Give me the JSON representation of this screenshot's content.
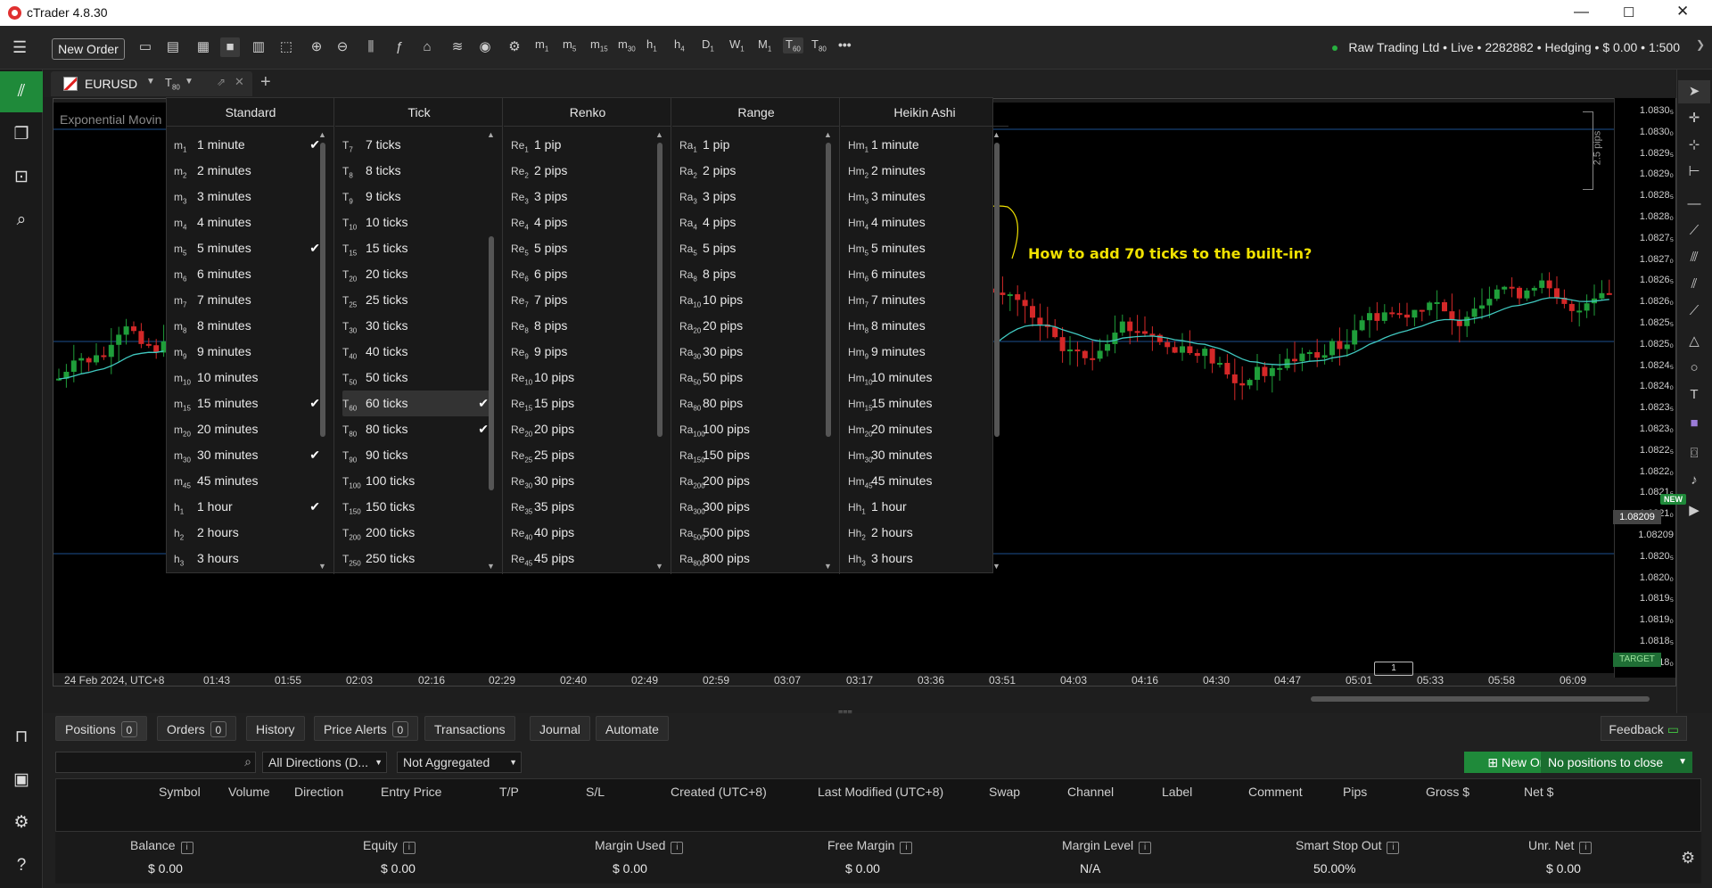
{
  "app": {
    "title": "cTrader 4.8.30"
  },
  "window_buttons": [
    "—",
    "☐",
    "✕"
  ],
  "toolbar": {
    "new_order_label": "New Order",
    "timeframes": [
      {
        "code": "m",
        "sub": "1"
      },
      {
        "code": "m",
        "sub": "5"
      },
      {
        "code": "m",
        "sub": "15"
      },
      {
        "code": "m",
        "sub": "30"
      },
      {
        "code": "h",
        "sub": "1"
      },
      {
        "code": "h",
        "sub": "4"
      },
      {
        "code": "D",
        "sub": "1"
      },
      {
        "code": "W",
        "sub": "1"
      },
      {
        "code": "M",
        "sub": "1"
      },
      {
        "code": "T",
        "sub": "60"
      },
      {
        "code": "T",
        "sub": "80"
      }
    ],
    "more": "•••",
    "account": "Raw Trading Ltd • Live • 2282882 • Hedging • $ 0.00 • 1:500"
  },
  "chart_tab": {
    "symbol": "EURUSD",
    "timeframe": "T",
    "timeframe_sub": "80",
    "add": "+"
  },
  "chart": {
    "indicator": "Exponential Movin",
    "annotation": "How to add 70 ticks to the built-in?",
    "price_labels": [
      "1.0830₅",
      "1.0830₀",
      "1.0829₅",
      "1.0829₀",
      "1.0828₅",
      "1.0828₀",
      "1.0827₅",
      "1.0827₀",
      "1.0826₅",
      "1.0826₀",
      "1.0825₅",
      "1.0825₀",
      "1.0824₅",
      "1.0824₀",
      "1.0823₅",
      "1.0823₀",
      "1.0822₅",
      "1.0822₀",
      "1.0821₅",
      "1.0821₀",
      "1.08209",
      "1.0820₅",
      "1.0820₀",
      "1.0819₅",
      "1.0819₀",
      "1.0818₅",
      "1.0818₀"
    ],
    "current_price": "1.08209",
    "pip_scale": "2.5 pips",
    "target_label": "TARGET",
    "time_labels": [
      "24 Feb 2024, UTC+8",
      "01:43",
      "01:55",
      "02:03",
      "02:16",
      "02:29",
      "02:40",
      "02:49",
      "02:59",
      "03:07",
      "03:17",
      "03:36",
      "03:51",
      "04:03",
      "04:16",
      "04:30",
      "04:47",
      "05:01",
      "05:33",
      "05:58",
      "06:09"
    ],
    "scroll_marker": "1"
  },
  "dropdown": {
    "columns": [
      {
        "title": "Standard",
        "items": [
          {
            "code": "m",
            "sub": "1",
            "label": "1 minute",
            "checked": true
          },
          {
            "code": "m",
            "sub": "2",
            "label": "2 minutes",
            "checked": false
          },
          {
            "code": "m",
            "sub": "3",
            "label": "3 minutes",
            "checked": false
          },
          {
            "code": "m",
            "sub": "4",
            "label": "4 minutes",
            "checked": false
          },
          {
            "code": "m",
            "sub": "5",
            "label": "5 minutes",
            "checked": true
          },
          {
            "code": "m",
            "sub": "6",
            "label": "6 minutes",
            "checked": false
          },
          {
            "code": "m",
            "sub": "7",
            "label": "7 minutes",
            "checked": false
          },
          {
            "code": "m",
            "sub": "8",
            "label": "8 minutes",
            "checked": false
          },
          {
            "code": "m",
            "sub": "9",
            "label": "9 minutes",
            "checked": false
          },
          {
            "code": "m",
            "sub": "10",
            "label": "10 minutes",
            "checked": false
          },
          {
            "code": "m",
            "sub": "15",
            "label": "15 minutes",
            "checked": true
          },
          {
            "code": "m",
            "sub": "20",
            "label": "20 minutes",
            "checked": false
          },
          {
            "code": "m",
            "sub": "30",
            "label": "30 minutes",
            "checked": true
          },
          {
            "code": "m",
            "sub": "45",
            "label": "45 minutes",
            "checked": false
          },
          {
            "code": "h",
            "sub": "1",
            "label": "1 hour",
            "checked": true
          },
          {
            "code": "h",
            "sub": "2",
            "label": "2 hours",
            "checked": false
          },
          {
            "code": "h",
            "sub": "3",
            "label": "3 hours",
            "checked": false
          }
        ]
      },
      {
        "title": "Tick",
        "items": [
          {
            "code": "T",
            "sub": "7",
            "label": "7 ticks",
            "checked": false
          },
          {
            "code": "T",
            "sub": "8",
            "label": "8 ticks",
            "checked": false
          },
          {
            "code": "T",
            "sub": "9",
            "label": "9 ticks",
            "checked": false
          },
          {
            "code": "T",
            "sub": "10",
            "label": "10 ticks",
            "checked": false
          },
          {
            "code": "T",
            "sub": "15",
            "label": "15 ticks",
            "checked": false
          },
          {
            "code": "T",
            "sub": "20",
            "label": "20 ticks",
            "checked": false
          },
          {
            "code": "T",
            "sub": "25",
            "label": "25 ticks",
            "checked": false
          },
          {
            "code": "T",
            "sub": "30",
            "label": "30 ticks",
            "checked": false
          },
          {
            "code": "T",
            "sub": "40",
            "label": "40 ticks",
            "checked": false
          },
          {
            "code": "T",
            "sub": "50",
            "label": "50 ticks",
            "checked": false
          },
          {
            "code": "T",
            "sub": "60",
            "label": "60 ticks",
            "checked": true
          },
          {
            "code": "T",
            "sub": "80",
            "label": "80 ticks",
            "checked": true
          },
          {
            "code": "T",
            "sub": "90",
            "label": "90 ticks",
            "checked": false
          },
          {
            "code": "T",
            "sub": "100",
            "label": "100 ticks",
            "checked": false
          },
          {
            "code": "T",
            "sub": "150",
            "label": "150 ticks",
            "checked": false
          },
          {
            "code": "T",
            "sub": "200",
            "label": "200 ticks",
            "checked": false
          },
          {
            "code": "T",
            "sub": "250",
            "label": "250 ticks",
            "checked": false
          }
        ]
      },
      {
        "title": "Renko",
        "items": [
          {
            "code": "Re",
            "sub": "1",
            "label": "1 pip",
            "checked": false
          },
          {
            "code": "Re",
            "sub": "2",
            "label": "2 pips",
            "checked": false
          },
          {
            "code": "Re",
            "sub": "3",
            "label": "3 pips",
            "checked": false
          },
          {
            "code": "Re",
            "sub": "4",
            "label": "4 pips",
            "checked": false
          },
          {
            "code": "Re",
            "sub": "5",
            "label": "5 pips",
            "checked": false
          },
          {
            "code": "Re",
            "sub": "6",
            "label": "6 pips",
            "checked": false
          },
          {
            "code": "Re",
            "sub": "7",
            "label": "7 pips",
            "checked": false
          },
          {
            "code": "Re",
            "sub": "8",
            "label": "8 pips",
            "checked": false
          },
          {
            "code": "Re",
            "sub": "9",
            "label": "9 pips",
            "checked": false
          },
          {
            "code": "Re",
            "sub": "10",
            "label": "10 pips",
            "checked": false
          },
          {
            "code": "Re",
            "sub": "15",
            "label": "15 pips",
            "checked": false
          },
          {
            "code": "Re",
            "sub": "20",
            "label": "20 pips",
            "checked": false
          },
          {
            "code": "Re",
            "sub": "25",
            "label": "25 pips",
            "checked": false
          },
          {
            "code": "Re",
            "sub": "30",
            "label": "30 pips",
            "checked": false
          },
          {
            "code": "Re",
            "sub": "35",
            "label": "35 pips",
            "checked": false
          },
          {
            "code": "Re",
            "sub": "40",
            "label": "40 pips",
            "checked": false
          },
          {
            "code": "Re",
            "sub": "45",
            "label": "45 pips",
            "checked": false
          }
        ]
      },
      {
        "title": "Range",
        "items": [
          {
            "code": "Ra",
            "sub": "1",
            "label": "1 pip",
            "checked": false
          },
          {
            "code": "Ra",
            "sub": "2",
            "label": "2 pips",
            "checked": false
          },
          {
            "code": "Ra",
            "sub": "3",
            "label": "3 pips",
            "checked": false
          },
          {
            "code": "Ra",
            "sub": "4",
            "label": "4 pips",
            "checked": false
          },
          {
            "code": "Ra",
            "sub": "5",
            "label": "5 pips",
            "checked": false
          },
          {
            "code": "Ra",
            "sub": "8",
            "label": "8 pips",
            "checked": false
          },
          {
            "code": "Ra",
            "sub": "10",
            "label": "10 pips",
            "checked": false
          },
          {
            "code": "Ra",
            "sub": "20",
            "label": "20 pips",
            "checked": false
          },
          {
            "code": "Ra",
            "sub": "30",
            "label": "30 pips",
            "checked": false
          },
          {
            "code": "Ra",
            "sub": "50",
            "label": "50 pips",
            "checked": false
          },
          {
            "code": "Ra",
            "sub": "80",
            "label": "80 pips",
            "checked": false
          },
          {
            "code": "Ra",
            "sub": "100",
            "label": "100 pips",
            "checked": false
          },
          {
            "code": "Ra",
            "sub": "150",
            "label": "150 pips",
            "checked": false
          },
          {
            "code": "Ra",
            "sub": "200",
            "label": "200 pips",
            "checked": false
          },
          {
            "code": "Ra",
            "sub": "300",
            "label": "300 pips",
            "checked": false
          },
          {
            "code": "Ra",
            "sub": "500",
            "label": "500 pips",
            "checked": false
          },
          {
            "code": "Ra",
            "sub": "800",
            "label": "800 pips",
            "checked": false
          }
        ]
      },
      {
        "title": "Heikin Ashi",
        "items": [
          {
            "code": "Hm",
            "sub": "1",
            "label": "1 minute",
            "checked": false
          },
          {
            "code": "Hm",
            "sub": "2",
            "label": "2 minutes",
            "checked": false
          },
          {
            "code": "Hm",
            "sub": "3",
            "label": "3 minutes",
            "checked": false
          },
          {
            "code": "Hm",
            "sub": "4",
            "label": "4 minutes",
            "checked": false
          },
          {
            "code": "Hm",
            "sub": "5",
            "label": "5 minutes",
            "checked": false
          },
          {
            "code": "Hm",
            "sub": "6",
            "label": "6 minutes",
            "checked": false
          },
          {
            "code": "Hm",
            "sub": "7",
            "label": "7 minutes",
            "checked": false
          },
          {
            "code": "Hm",
            "sub": "8",
            "label": "8 minutes",
            "checked": false
          },
          {
            "code": "Hm",
            "sub": "9",
            "label": "9 minutes",
            "checked": false
          },
          {
            "code": "Hm",
            "sub": "10",
            "label": "10 minutes",
            "checked": false
          },
          {
            "code": "Hm",
            "sub": "15",
            "label": "15 minutes",
            "checked": false
          },
          {
            "code": "Hm",
            "sub": "20",
            "label": "20 minutes",
            "checked": false
          },
          {
            "code": "Hm",
            "sub": "30",
            "label": "30 minutes",
            "checked": false
          },
          {
            "code": "Hm",
            "sub": "45",
            "label": "45 minutes",
            "checked": false
          },
          {
            "code": "Hh",
            "sub": "1",
            "label": "1 hour",
            "checked": false
          },
          {
            "code": "Hh",
            "sub": "2",
            "label": "2 hours",
            "checked": false
          },
          {
            "code": "Hh",
            "sub": "3",
            "label": "3 hours",
            "checked": false
          }
        ]
      }
    ]
  },
  "bottom": {
    "tabs": [
      {
        "label": "Positions",
        "count": "0"
      },
      {
        "label": "Orders",
        "count": "0"
      },
      {
        "label": "History",
        "count": ""
      },
      {
        "label": "Price Alerts",
        "count": "0"
      },
      {
        "label": "Transactions",
        "count": ""
      },
      {
        "label": "Journal",
        "count": ""
      },
      {
        "label": "Automate",
        "count": ""
      }
    ],
    "feedback": "Feedback",
    "filter_direction": "All Directions (D...",
    "filter_aggregation": "Not Aggregated",
    "new_order": "New Order",
    "no_positions": "No positions to close",
    "columns": [
      "Symbol",
      "Volume",
      "Direction",
      "Entry Price",
      "T/P",
      "S/L",
      "Created (UTC+8)",
      "Last Modified (UTC+8)",
      "Swap",
      "Channel",
      "Label",
      "Comment",
      "Pips",
      "Gross $",
      "Net $"
    ],
    "summary": [
      {
        "label": "Balance",
        "value": "$ 0.00"
      },
      {
        "label": "Equity",
        "value": "$ 0.00"
      },
      {
        "label": "Margin Used",
        "value": "$ 0.00"
      },
      {
        "label": "Free Margin",
        "value": "$ 0.00"
      },
      {
        "label": "Margin Level",
        "value": "N/A"
      },
      {
        "label": "Smart Stop Out",
        "value": "50.00%"
      },
      {
        "label": "Unr. Net",
        "value": "$ 0.00"
      }
    ]
  },
  "right_toolbar": {
    "new_badge": "NEW"
  },
  "colors": {
    "bull": "#1f9e3a",
    "bear": "#d42828",
    "ema": "#40c8c0",
    "annotation": "#f1e200",
    "accent": "#1f8a3a"
  }
}
